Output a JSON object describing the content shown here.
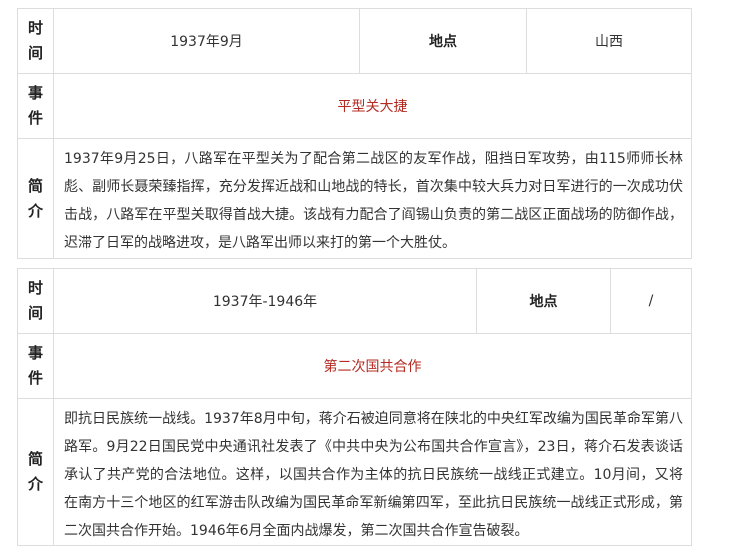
{
  "labels": {
    "time": "时间",
    "event": "事件",
    "intro": "简介",
    "place": "地点"
  },
  "entries": [
    {
      "time_value": "1937年9月",
      "place_value": "山西",
      "event_name": "平型关大捷",
      "description": "1937年9月25日，八路军在平型关为了配合第二战区的友军作战，阻挡日军攻势，由115师师长林彪、副师长聂荣臻指挥，充分发挥近战和山地战的特长，首次集中较大兵力对日军进行的一次成功伏击战，八路军在平型关取得首战大捷。该战有力配合了阎锡山负责的第二战区正面战场的防御作战，迟滞了日军的战略进攻，是八路军出师以来打的第一个大胜仗。"
    },
    {
      "time_value": "1937年-1946年",
      "place_value": "/",
      "event_name": "第二次国共合作",
      "description": "即抗日民族统一战线。1937年8月中旬，蒋介石被迫同意将在陕北的中央红军改编为国民革命军第八路军。9月22日国民党中央通讯社发表了《中共中央为公布国共合作宣言》，23日，蒋介石发表谈话承认了共产党的合法地位。这样，以国共合作为主体的抗日民族统一战线正式建立。10月间，又将在南方十三个地区的红军游击队改编为国民革命军新编第四军，至此抗日民族统一战线正式形成，第二次国共合作开始。1946年6月全面内战爆发，第二次国共合作宣告破裂。"
    }
  ],
  "colors": {
    "event_text": "#b52b22",
    "border": "#dddddd",
    "body_text": "#333333"
  }
}
